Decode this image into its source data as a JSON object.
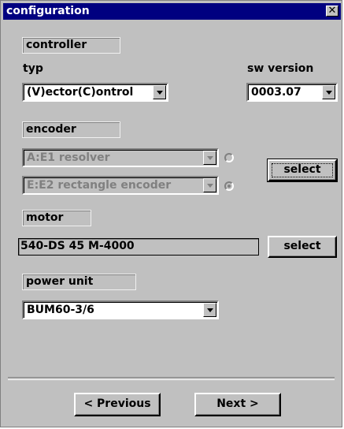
{
  "window": {
    "title": "configuration"
  },
  "controller": {
    "group_label": "controller",
    "typ_label": "typ",
    "typ_value": "(V)ector(C)ontrol",
    "sw_version_label": "sw version",
    "sw_version_value": "0003.07"
  },
  "encoder": {
    "group_label": "encoder",
    "e1_value": "A:E1 resolver",
    "e2_value": "E:E2 rectangle encoder",
    "e1_selected": false,
    "e2_selected": true,
    "select_label": "select"
  },
  "motor": {
    "group_label": "motor",
    "value": "540-DS 45 M-4000",
    "select_label": "select"
  },
  "power_unit": {
    "group_label": "power unit",
    "value": "BUM60-3/6"
  },
  "nav": {
    "previous_label": "< Previous",
    "next_label": "Next >"
  },
  "icons": {
    "close": "close-icon",
    "dropdown": "chevron-down-icon"
  }
}
